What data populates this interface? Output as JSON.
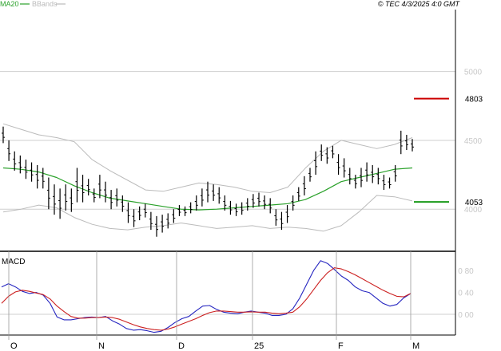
{
  "header": {
    "legend": [
      {
        "name": "MA20",
        "color": "#2aa12a"
      },
      {
        "name": "BBands",
        "color": "#bbbbbb"
      }
    ],
    "info": "© TEC 4/3/2025 4:0 GMT"
  },
  "chart_data": [
    {
      "type": "ohlc",
      "ylim": [
        3700,
        5450
      ],
      "yticks": [
        "4000",
        "4500",
        "5000"
      ],
      "x_labels": [
        "O",
        "N",
        "D",
        "25",
        "F",
        "M"
      ],
      "levels": [
        {
          "value": 4803,
          "label": "4803",
          "color": "#cc0000"
        },
        {
          "value": 4053,
          "label": "4053",
          "color": "#1a9a1a"
        }
      ],
      "bars": [
        [
          4600,
          4480
        ],
        [
          4500,
          4350
        ],
        [
          4420,
          4280
        ],
        [
          4390,
          4260
        ],
        [
          4360,
          4220
        ],
        [
          4340,
          4200
        ],
        [
          4320,
          4150
        ],
        [
          4300,
          4150
        ],
        [
          4230,
          4000
        ],
        [
          4180,
          3960
        ],
        [
          4150,
          3930
        ],
        [
          4180,
          3990
        ],
        [
          4150,
          3980
        ],
        [
          4300,
          4050
        ],
        [
          4250,
          4050
        ],
        [
          4220,
          4100
        ],
        [
          4150,
          4050
        ],
        [
          4250,
          4080
        ],
        [
          4200,
          4050
        ],
        [
          4140,
          4000
        ],
        [
          4150,
          4020
        ],
        [
          4100,
          3980
        ],
        [
          4050,
          3900
        ],
        [
          4000,
          3870
        ],
        [
          4020,
          3920
        ],
        [
          4040,
          3940
        ],
        [
          3980,
          3850
        ],
        [
          3950,
          3800
        ],
        [
          3960,
          3830
        ],
        [
          3970,
          3860
        ],
        [
          4000,
          3900
        ],
        [
          4030,
          3950
        ],
        [
          4020,
          3950
        ],
        [
          4050,
          3970
        ],
        [
          4100,
          3990
        ],
        [
          4150,
          4020
        ],
        [
          4200,
          4050
        ],
        [
          4180,
          4060
        ],
        [
          4160,
          4040
        ],
        [
          4100,
          3990
        ],
        [
          4060,
          3960
        ],
        [
          4040,
          3950
        ],
        [
          4050,
          3960
        ],
        [
          4080,
          3990
        ],
        [
          4110,
          4010
        ],
        [
          4120,
          4020
        ],
        [
          4100,
          4000
        ],
        [
          4080,
          3970
        ],
        [
          4000,
          3880
        ],
        [
          3980,
          3850
        ],
        [
          4030,
          3900
        ],
        [
          4100,
          3990
        ],
        [
          4160,
          4060
        ],
        [
          4240,
          4100
        ],
        [
          4300,
          4200
        ],
        [
          4420,
          4250
        ],
        [
          4470,
          4350
        ],
        [
          4450,
          4330
        ],
        [
          4460,
          4370
        ],
        [
          4400,
          4250
        ],
        [
          4370,
          4230
        ],
        [
          4300,
          4180
        ],
        [
          4250,
          4150
        ],
        [
          4300,
          4160
        ],
        [
          4340,
          4200
        ],
        [
          4320,
          4190
        ],
        [
          4300,
          4180
        ],
        [
          4250,
          4140
        ],
        [
          4230,
          4150
        ],
        [
          4320,
          4200
        ],
        [
          4570,
          4400
        ],
        [
          4540,
          4430
        ],
        [
          4510,
          4420
        ]
      ],
      "ma20": [
        4300,
        4290,
        4270,
        4230,
        4170,
        4120,
        4080,
        4060,
        4040,
        4020,
        4000,
        3995,
        4000,
        4010,
        4020,
        4030,
        4040,
        4070,
        4130,
        4200,
        4230,
        4260,
        4290,
        4300
      ],
      "bb_upper": [
        4620,
        4580,
        4540,
        4520,
        4490,
        4360,
        4280,
        4210,
        4140,
        4130,
        4160,
        4190,
        4180,
        4160,
        4130,
        4120,
        4160,
        4300,
        4420,
        4500,
        4470,
        4440,
        4470,
        4520
      ],
      "bb_lower": [
        3980,
        4000,
        4030,
        4010,
        3940,
        3890,
        3860,
        3850,
        3870,
        3880,
        3900,
        3880,
        3860,
        3870,
        3880,
        3860,
        3870,
        3860,
        3840,
        3880,
        3980,
        4100,
        4090,
        4060
      ]
    },
    {
      "type": "line",
      "title": "MACD",
      "ylim": [
        -350,
        1050
      ],
      "yticks": [
        "0",
        "400",
        "800"
      ],
      "tick_labels": [
        "0 00",
        "0 40",
        "0 80"
      ],
      "zero_line": 0,
      "series": [
        {
          "color": "#2525c0",
          "values": [
            500,
            560,
            500,
            420,
            380,
            400,
            350,
            200,
            -50,
            -100,
            -100,
            -80,
            -60,
            -50,
            -60,
            -40,
            -120,
            -180,
            -260,
            -290,
            -280,
            -300,
            -330,
            -310,
            -240,
            -150,
            -80,
            -40,
            60,
            150,
            160,
            90,
            40,
            20,
            10,
            40,
            60,
            40,
            20,
            -20,
            -20,
            0,
            100,
            300,
            550,
            800,
            980,
            930,
            820,
            700,
            620,
            500,
            430,
            400,
            300,
            200,
            150,
            180,
            300,
            380
          ]
        },
        {
          "color": "#cc2020",
          "values": [
            200,
            330,
            410,
            440,
            420,
            390,
            360,
            280,
            150,
            50,
            -40,
            -70,
            -70,
            -60,
            -60,
            -50,
            -60,
            -90,
            -140,
            -190,
            -230,
            -260,
            -280,
            -290,
            -270,
            -230,
            -180,
            -130,
            -80,
            -20,
            30,
            60,
            60,
            50,
            40,
            40,
            45,
            40,
            40,
            20,
            10,
            20,
            40,
            140,
            280,
            450,
            620,
            760,
            850,
            830,
            780,
            720,
            650,
            580,
            510,
            440,
            380,
            330,
            320,
            380
          ]
        }
      ]
    }
  ]
}
